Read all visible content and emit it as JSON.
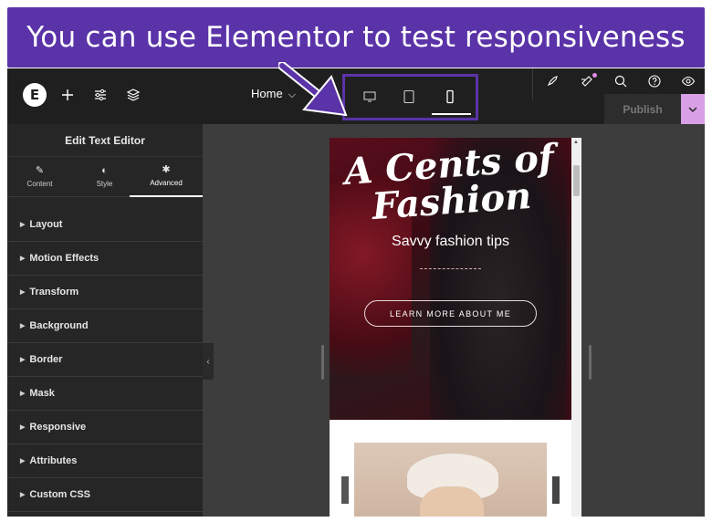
{
  "banner": {
    "text": "You can use Elementor to test responsiveness"
  },
  "topbar": {
    "logo_letter": "E",
    "icons": [
      "plus-icon",
      "sliders-icon",
      "layers-icon"
    ],
    "page_selector": "Home",
    "devices": [
      "desktop-icon",
      "tablet-icon",
      "mobile-icon"
    ],
    "active_device": "mobile",
    "right_icons": [
      "rocket-icon",
      "notes-icon",
      "search-icon",
      "help-icon",
      "preview-icon"
    ],
    "publish_label": "Publish"
  },
  "panel": {
    "title": "Edit Text Editor",
    "tabs": [
      {
        "label": "Content",
        "icon": "pencil-icon"
      },
      {
        "label": "Style",
        "icon": "contrast-icon"
      },
      {
        "label": "Advanced",
        "icon": "gear-icon"
      }
    ],
    "active_tab": "Advanced",
    "sections": [
      "Layout",
      "Motion Effects",
      "Transform",
      "Background",
      "Border",
      "Mask",
      "Responsive",
      "Attributes",
      "Custom CSS"
    ]
  },
  "preview": {
    "script_title_line1": "A Cents of",
    "script_title_line2": "Fashion",
    "tagline": "Savvy fashion tips",
    "cta_label": "LEARN MORE ABOUT ME"
  },
  "colors": {
    "banner": "#5b33a8",
    "topbar": "#1f1f1f",
    "panel": "#262626",
    "canvas": "#3d3d3d",
    "publish_arrow": "#d9a0e6"
  }
}
